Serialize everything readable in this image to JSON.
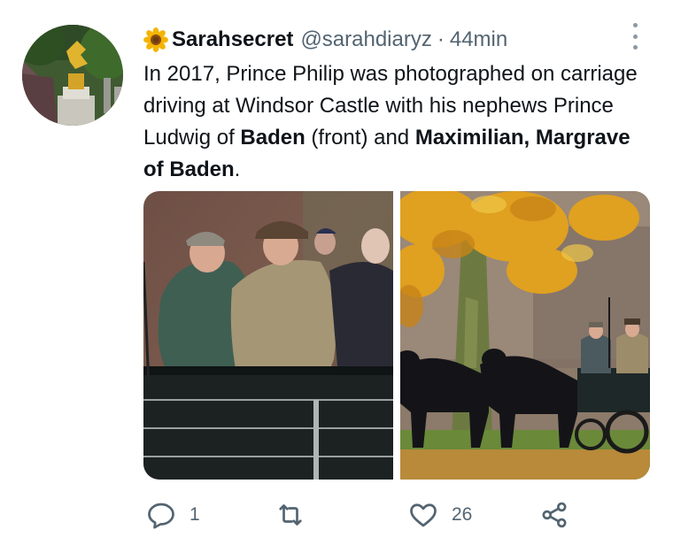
{
  "tweet": {
    "display_name": "Sarahsecret",
    "handle": "@sarahdiaryz",
    "separator": "·",
    "time": "44min",
    "name_emoji": "sunflower-icon",
    "text_parts": {
      "p1": "In 2017, Prince Philip was photographed on carriage driving at Windsor Castle with his nephews Prince Ludwig of ",
      "b1": "Baden",
      "p2": " (front) and ",
      "b2": "Maximilian, Margrave of Baden",
      "p3": "."
    },
    "media": [
      {
        "icon": "carriage-closeup-photo"
      },
      {
        "icon": "horses-carriage-autumn-photo"
      }
    ]
  },
  "actions": {
    "reply": {
      "icon": "reply-icon",
      "count": "1"
    },
    "retweet": {
      "icon": "retweet-icon",
      "count": ""
    },
    "like": {
      "icon": "heart-icon",
      "count": "26"
    },
    "share": {
      "icon": "share-icon"
    }
  },
  "colors": {
    "text": "#0f1419",
    "secondary": "#536471",
    "more_dots": "#8b98a5"
  }
}
